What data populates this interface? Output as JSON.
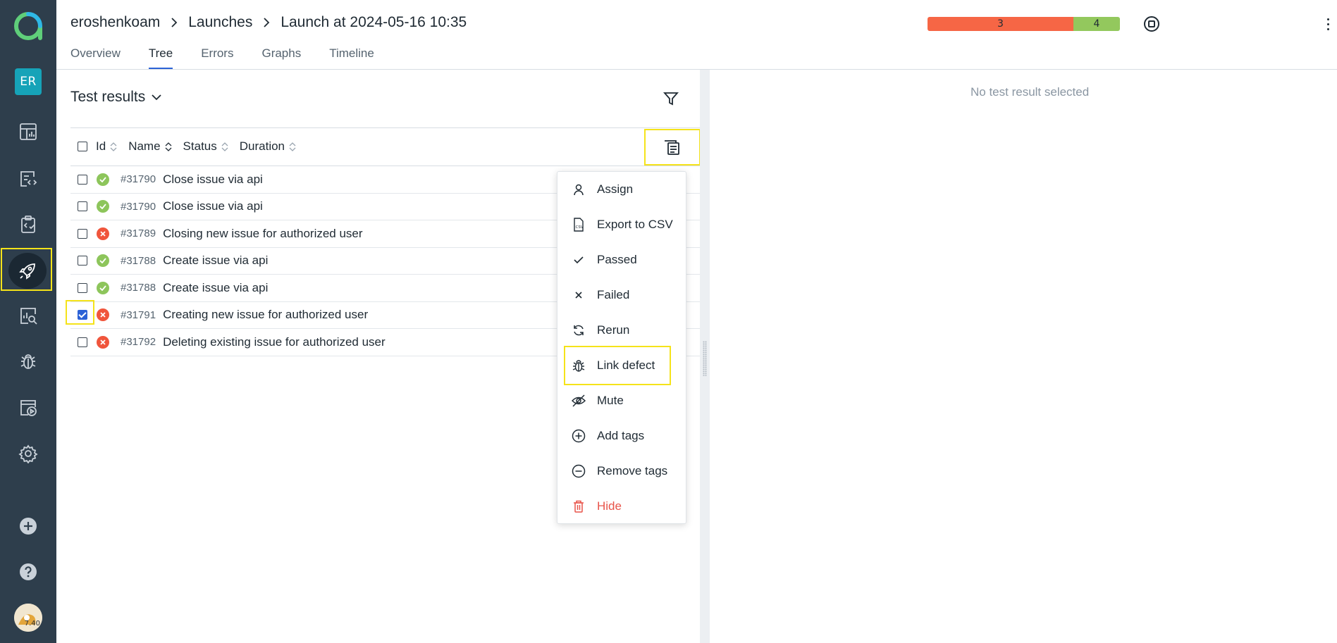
{
  "breadcrumb": {
    "project": "eroshenkoam",
    "section": "Launches",
    "launch": "Launch at 2024-05-16 10:35"
  },
  "tabs": [
    {
      "label": "Overview",
      "active": false
    },
    {
      "label": "Tree",
      "active": true
    },
    {
      "label": "Errors",
      "active": false
    },
    {
      "label": "Graphs",
      "active": false
    },
    {
      "label": "Timeline",
      "active": false
    }
  ],
  "stats": {
    "failed": "3",
    "passed": "4",
    "failed_color": "#f66645",
    "passed_color": "#93c85d"
  },
  "sidebar": {
    "user_initials": "ER",
    "icons": [
      "dashboard-icon",
      "test-cases-icon",
      "test-plans-icon",
      "launches-icon",
      "analytics-icon",
      "defects-icon",
      "jobs-icon",
      "settings-icon",
      "add-icon",
      "help-icon"
    ],
    "avatar_badge": "7.40"
  },
  "results": {
    "title": "Test results",
    "columns": [
      "Id",
      "Name",
      "Status",
      "Duration"
    ],
    "rows": [
      {
        "id": "#31790",
        "name": "Close issue via api",
        "status": "passed",
        "checked": false
      },
      {
        "id": "#31790",
        "name": "Close issue via api",
        "status": "passed",
        "checked": false
      },
      {
        "id": "#31789",
        "name": "Closing new issue for authorized user",
        "status": "failed",
        "checked": false
      },
      {
        "id": "#31788",
        "name": "Create issue via api",
        "status": "passed",
        "checked": false
      },
      {
        "id": "#31788",
        "name": "Create issue via api",
        "status": "passed",
        "checked": false
      },
      {
        "id": "#31791",
        "name": "Creating new issue for authorized user",
        "status": "failed",
        "checked": true
      },
      {
        "id": "#31792",
        "name": "Deleting existing issue for authorized user",
        "status": "failed",
        "checked": false
      }
    ]
  },
  "menu": {
    "items": [
      {
        "label": "Assign",
        "icon": "user-icon"
      },
      {
        "label": "Export to CSV",
        "icon": "csv-icon"
      },
      {
        "label": "Passed",
        "icon": "check-icon"
      },
      {
        "label": "Failed",
        "icon": "close-icon"
      },
      {
        "label": "Rerun",
        "icon": "rerun-icon"
      },
      {
        "label": "Link defect",
        "icon": "bug-icon"
      },
      {
        "label": "Mute",
        "icon": "eye-off-icon"
      },
      {
        "label": "Add tags",
        "icon": "plus-circle-icon"
      },
      {
        "label": "Remove tags",
        "icon": "minus-circle-icon"
      },
      {
        "label": "Hide",
        "icon": "trash-icon"
      }
    ]
  },
  "detail": {
    "empty_text": "No test result selected"
  }
}
